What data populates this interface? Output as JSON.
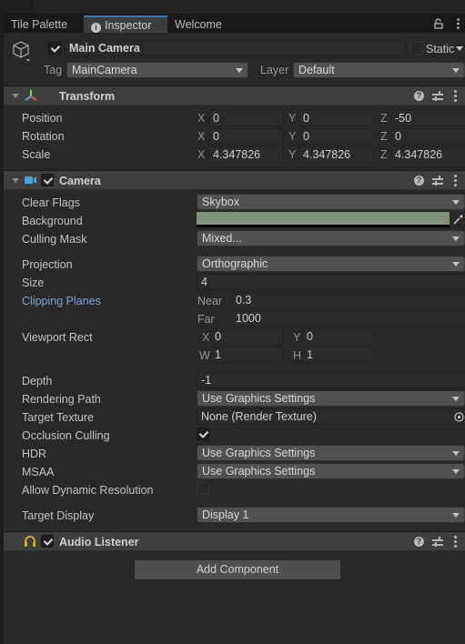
{
  "tabs": [
    {
      "label": "Tile Palette"
    },
    {
      "label": "Inspector",
      "icon": "info-icon"
    },
    {
      "label": "Welcome"
    }
  ],
  "window_icons": [
    "lock-icon",
    "kebab-menu-icon"
  ],
  "object": {
    "active": true,
    "name": "Main Camera",
    "static_label": "Static",
    "static": false,
    "tag_label": "Tag",
    "tag": "MainCamera",
    "layer_label": "Layer",
    "layer": "Default"
  },
  "transform": {
    "title": "Transform",
    "rows": [
      {
        "label": "Position",
        "x": "0",
        "y": "0",
        "z": "-50"
      },
      {
        "label": "Rotation",
        "x": "0",
        "y": "0",
        "z": "0"
      },
      {
        "label": "Scale",
        "x": "4.347826",
        "y": "4.347826",
        "z": "4.347826"
      }
    ]
  },
  "axis": {
    "x": "X",
    "y": "Y",
    "z": "Z",
    "w": "W",
    "h": "H"
  },
  "camera": {
    "title": "Camera",
    "enabled": true,
    "clear_flags": {
      "label": "Clear Flags",
      "value": "Skybox"
    },
    "background": {
      "label": "Background",
      "color": "#7f937a"
    },
    "culling_mask": {
      "label": "Culling Mask",
      "value": "Mixed..."
    },
    "projection": {
      "label": "Projection",
      "value": "Orthographic"
    },
    "size": {
      "label": "Size",
      "value": "4"
    },
    "clipping": {
      "label": "Clipping Planes",
      "near_label": "Near",
      "near": "0.3",
      "far_label": "Far",
      "far": "1000"
    },
    "viewport": {
      "label": "Viewport Rect",
      "x": "0",
      "y": "0",
      "w": "1",
      "h": "1"
    },
    "depth": {
      "label": "Depth",
      "value": "-1"
    },
    "rendering_path": {
      "label": "Rendering Path",
      "value": "Use Graphics Settings"
    },
    "target_texture": {
      "label": "Target Texture",
      "value": "None (Render Texture)"
    },
    "occlusion_culling": {
      "label": "Occlusion Culling",
      "checked": true
    },
    "hdr": {
      "label": "HDR",
      "value": "Use Graphics Settings"
    },
    "msaa": {
      "label": "MSAA",
      "value": "Use Graphics Settings"
    },
    "dynamic_resolution": {
      "label": "Allow Dynamic Resolution",
      "checked": false
    },
    "target_display": {
      "label": "Target Display",
      "value": "Display 1"
    }
  },
  "audio_listener": {
    "title": "Audio Listener",
    "enabled": true
  },
  "add_component_label": "Add Component",
  "colors": {
    "accent": "#3a79bb",
    "link": "#7ea6d8",
    "audio_icon": "#e6b422"
  }
}
